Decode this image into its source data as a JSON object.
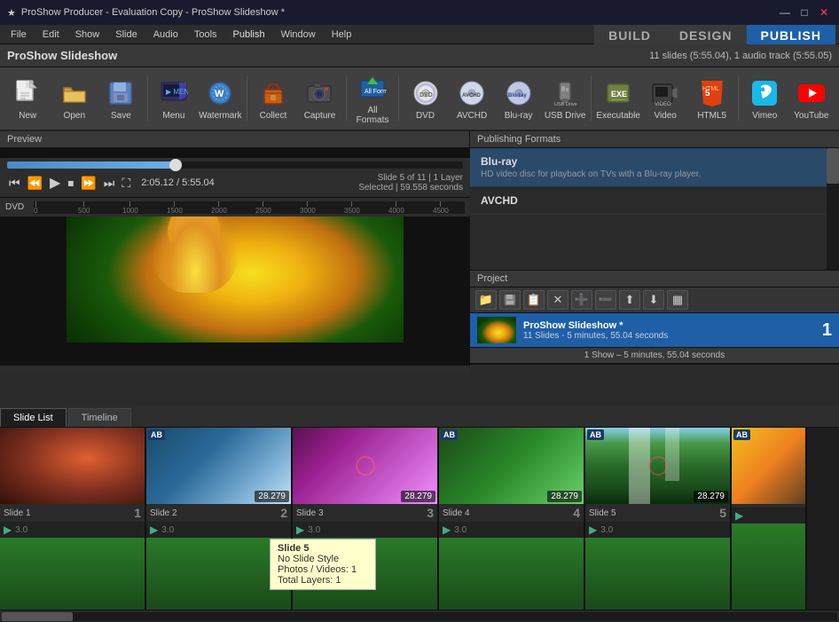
{
  "titlebar": {
    "title": "ProShow Producer - Evaluation Copy - ProShow Slideshow *",
    "icon": "★",
    "minimize": "—",
    "maximize": "□",
    "close": "✕"
  },
  "menubar": {
    "items": [
      "File",
      "Edit",
      "Show",
      "Slide",
      "Audio",
      "Tools",
      "Publish",
      "Window",
      "Help"
    ]
  },
  "modes": {
    "build": "BUILD",
    "design": "DESIGN",
    "publish": "PUBLISH"
  },
  "appheader": {
    "title": "ProShow Slideshow",
    "slide_info": "11 slides (5:55.04), 1 audio track (5:55.05)"
  },
  "toolbar": {
    "buttons": [
      {
        "id": "new",
        "label": "New",
        "icon": "📄"
      },
      {
        "id": "open",
        "label": "Open",
        "icon": "📂"
      },
      {
        "id": "save",
        "label": "Save",
        "icon": "💾"
      },
      {
        "id": "menu",
        "label": "Menu",
        "icon": "🎬"
      },
      {
        "id": "watermark",
        "label": "Watermark",
        "icon": "🔒"
      },
      {
        "id": "collect",
        "label": "Collect",
        "icon": "🎁"
      },
      {
        "id": "capture",
        "label": "Capture",
        "icon": "📷"
      },
      {
        "id": "all_formats",
        "label": "All Formats",
        "icon": "⬆"
      },
      {
        "id": "dvd",
        "label": "DVD",
        "icon": "💿"
      },
      {
        "id": "avchd",
        "label": "AVCHD",
        "icon": "💿"
      },
      {
        "id": "bluray",
        "label": "Blu-ray",
        "icon": "💿"
      },
      {
        "id": "usb_drive",
        "label": "USB Drive",
        "icon": "💾"
      },
      {
        "id": "executable",
        "label": "Executable",
        "icon": "⚙"
      },
      {
        "id": "video",
        "label": "Video",
        "icon": "📹"
      },
      {
        "id": "html5",
        "label": "HTML5",
        "icon": "🌐"
      },
      {
        "id": "vimeo",
        "label": "Vimeo",
        "icon": "▶"
      },
      {
        "id": "youtube",
        "label": "YouTube",
        "icon": "▶"
      }
    ]
  },
  "preview": {
    "label": "Preview"
  },
  "transport": {
    "time_current": "2:05.12",
    "time_total": "5:55.04",
    "time_display": "2:05.12 / 5:55.04",
    "slide_info": "Slide 5 of 11  |  1 Layer",
    "slide_detail": "Selected  |  59.558 seconds",
    "progress_pct": 37
  },
  "dvd_area": {
    "label": "DVD",
    "ruler_marks": [
      "0",
      "500",
      "1000",
      "1500",
      "2000",
      "2500",
      "3000",
      "3500",
      "4000",
      "4500"
    ]
  },
  "publish_panel": {
    "header": "Publishing Formats",
    "formats": [
      {
        "id": "bluray",
        "title": "Blu-ray",
        "desc": "HD video disc for playback on TVs with a Blu-ray player."
      },
      {
        "id": "avchd",
        "title": "AVCHD",
        "desc": ""
      }
    ]
  },
  "project": {
    "header": "Project",
    "toolbar_buttons": [
      "📁",
      "💾",
      "📋",
      "✕",
      "➕",
      "➖",
      "⬆",
      "⬇",
      "📊"
    ],
    "item": {
      "name": "ProShow Slideshow *",
      "detail": "11 Slides - 5 minutes, 55.04 seconds",
      "number": "1"
    },
    "footer": "1 Show – 5 minutes, 55.04 seconds"
  },
  "slide_area": {
    "tabs": [
      "Slide List",
      "Timeline"
    ],
    "active_tab": "Slide List",
    "slides": [
      {
        "id": 1,
        "name": "Slide 1",
        "number": "1",
        "time": "3.0",
        "color_class": "st-1",
        "has_ab": false,
        "overlay": ""
      },
      {
        "id": 2,
        "name": "Slide 2",
        "number": "2",
        "time": "3.0",
        "color_class": "st-2",
        "has_ab": true,
        "overlay": "28.279"
      },
      {
        "id": 3,
        "name": "Slide 3",
        "number": "3",
        "time": "3.0",
        "color_class": "st-3",
        "has_ab": false,
        "overlay": "28.279"
      },
      {
        "id": 4,
        "name": "Slide 4",
        "number": "4",
        "time": "3.0",
        "color_class": "st-4",
        "has_ab": true,
        "overlay": "28.279"
      },
      {
        "id": 5,
        "name": "Slide 5",
        "number": "5",
        "time": "3.0",
        "color_class": "waterfall-bg",
        "has_ab": true,
        "overlay": "28.279"
      }
    ]
  },
  "tooltip": {
    "line1": "Slide 5",
    "line2": "No Slide Style",
    "line3": "Photos / Videos: 1",
    "line4": "Total Layers: 1"
  },
  "hscrollbar": {}
}
